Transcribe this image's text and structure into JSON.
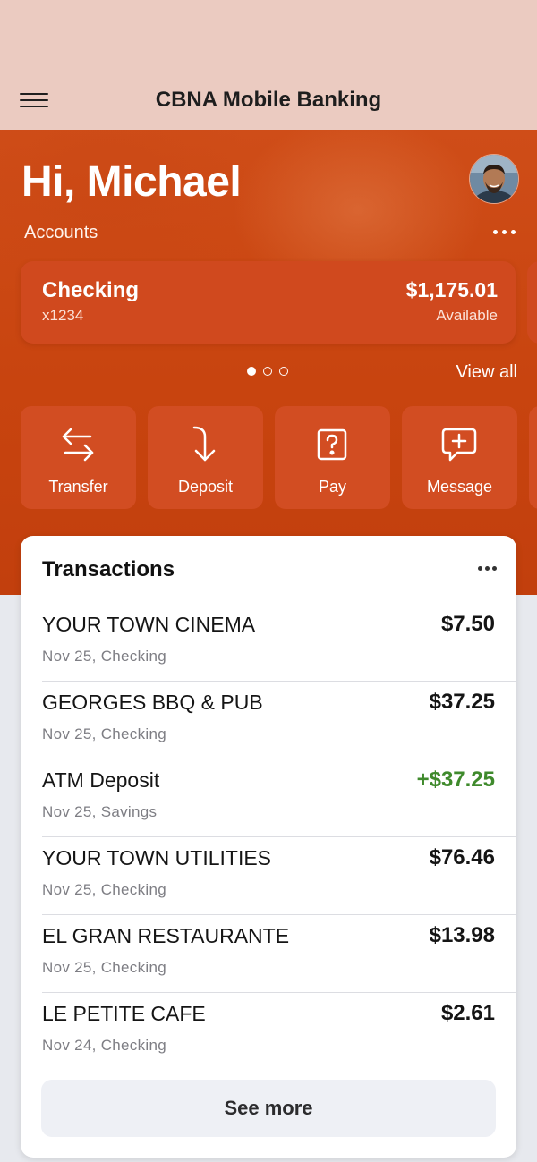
{
  "header": {
    "title": "CBNA Mobile Banking",
    "menu_icon": "hamburger-menu-icon"
  },
  "greeting": "Hi, Michael",
  "accounts": {
    "label": "Accounts",
    "cards": [
      {
        "name": "Checking",
        "number": "x1234",
        "balance": "$1,175.01",
        "balance_label": "Available"
      }
    ],
    "pager": {
      "count": 3,
      "active": 0
    },
    "view_all": "View all"
  },
  "actions": [
    {
      "label": "Transfer",
      "icon": "transfer-arrows-icon"
    },
    {
      "label": "Deposit",
      "icon": "deposit-arrow-icon"
    },
    {
      "label": "Pay",
      "icon": "pay-question-icon"
    },
    {
      "label": "Message",
      "icon": "message-plus-icon"
    }
  ],
  "transactions": {
    "title": "Transactions",
    "items": [
      {
        "name": "YOUR TOWN CINEMA",
        "meta": "Nov 25, Checking",
        "amount": "$7.50",
        "credit": false
      },
      {
        "name": "GEORGES BBQ & PUB",
        "meta": "Nov 25, Checking",
        "amount": "$37.25",
        "credit": false
      },
      {
        "name": "ATM Deposit",
        "meta": "Nov 25, Savings",
        "amount": "+$37.25",
        "credit": true
      },
      {
        "name": "YOUR TOWN UTILITIES",
        "meta": "Nov 25, Checking",
        "amount": "$76.46",
        "credit": false
      },
      {
        "name": "EL GRAN RESTAURANTE",
        "meta": "Nov 25, Checking",
        "amount": "$13.98",
        "credit": false
      },
      {
        "name": "LE PETITE CAFE",
        "meta": "Nov 24, Checking",
        "amount": "$2.61",
        "credit": false
      }
    ],
    "see_more": "See more"
  },
  "colors": {
    "brand": "#c8440f",
    "header_bg": "#ebcbc1",
    "credit": "#3f8a2c"
  }
}
